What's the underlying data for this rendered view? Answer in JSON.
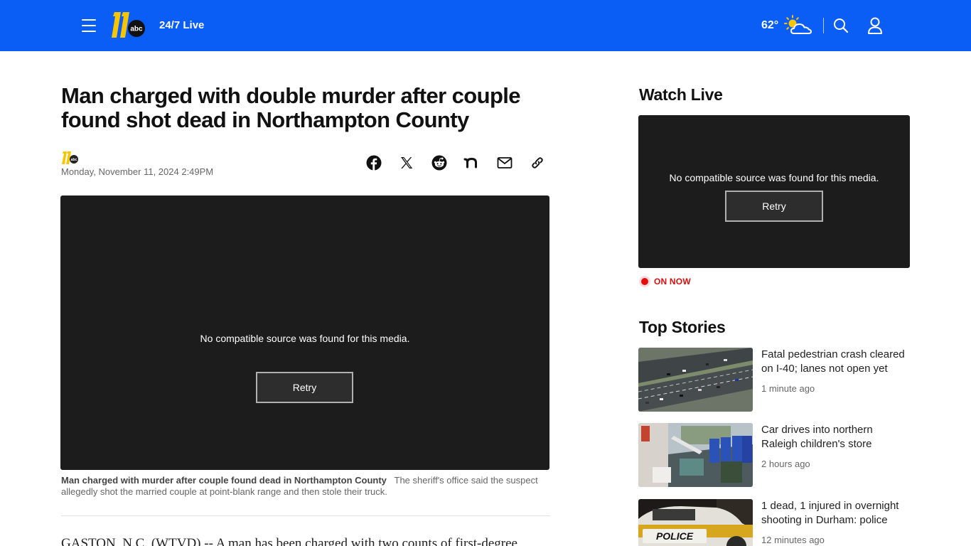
{
  "header": {
    "live_label": "24/7 Live",
    "temperature": "62°",
    "weather_icon": "partly-cloudy-icon",
    "brand_color": "#0a5df5"
  },
  "article": {
    "headline": "Man charged with double murder after couple found shot dead in Northampton County",
    "dateline": "Monday, November 11, 2024 2:49PM",
    "share_icons": [
      "facebook-icon",
      "x-icon",
      "reddit-icon",
      "nextdoor-icon",
      "email-icon",
      "link-icon"
    ],
    "player": {
      "message": "No compatible source was found for this media.",
      "retry_label": "Retry"
    },
    "caption_title": "Man charged with murder after couple found dead in Northampton County",
    "caption_text": "The sheriff's office said the suspect allegedly shot the married couple at point-blank range and then stole their truck.",
    "body_start": "GASTON, N.C. (WTVD) -- A man has been charged with two counts of first-degree"
  },
  "sidebar": {
    "watch_live_title": "Watch Live",
    "player": {
      "message": "No compatible source was found for this media.",
      "retry_label": "Retry"
    },
    "on_now_label": "ON NOW",
    "top_stories_title": "Top Stories",
    "stories": [
      {
        "title": "Fatal pedestrian crash cleared on I-40; lanes not open yet",
        "time": "1 minute ago"
      },
      {
        "title": "Car drives into northern Raleigh children's store",
        "time": "2 hours ago"
      },
      {
        "title": "1 dead, 1 injured in overnight shooting in Durham: police",
        "time": "12 minutes ago"
      }
    ]
  }
}
